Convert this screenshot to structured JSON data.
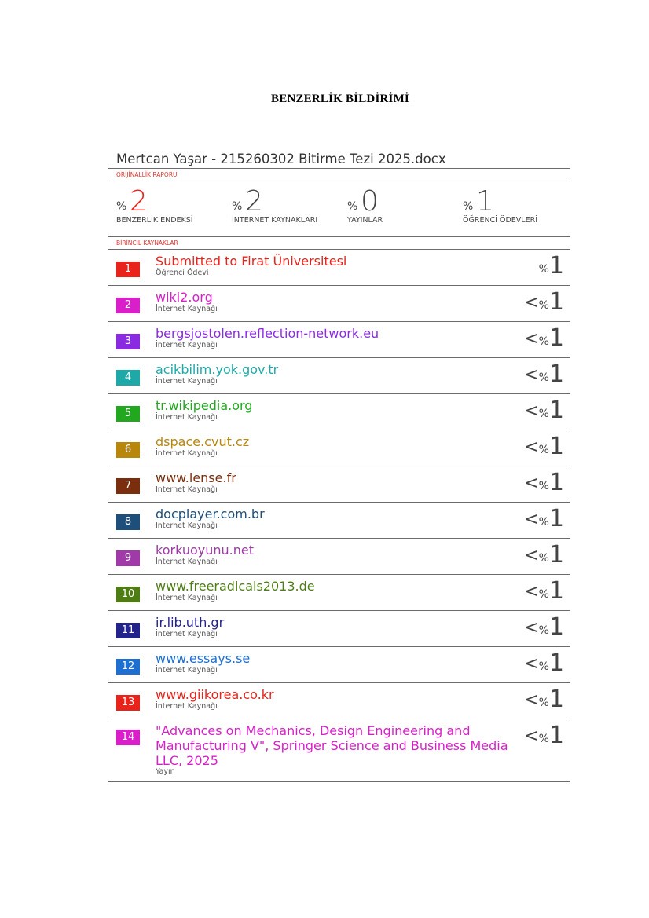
{
  "heading": "BENZERLİK BİLDİRİMİ",
  "report": {
    "title": "Mertcan Yaşar - 215260302 Bitirme Tezi 2025.docx",
    "originality_label": "ORİJİNALLİK RAPORU",
    "stats": [
      {
        "symbol": "%",
        "value": "2",
        "label": "BENZERLİK ENDEKSİ",
        "color": "#e8231c"
      },
      {
        "symbol": "%",
        "value": "2",
        "label": "İNTERNET KAYNAKLARI",
        "color": "#444444"
      },
      {
        "symbol": "%",
        "value": "0",
        "label": "YAYINLAR",
        "color": "#444444"
      },
      {
        "symbol": "%",
        "value": "1",
        "label": "ÖĞRENCİ ÖDEVLERİ",
        "color": "#444444"
      }
    ],
    "sources_label": "BİRİNCİL KAYNAKLAR",
    "sources": [
      {
        "num": "1",
        "name": "Submitted to Firat Üniversitesi",
        "type": "Öğrenci Ödevi",
        "lt": "",
        "pct_symbol": "%",
        "pct": "1",
        "color": "#e8231c"
      },
      {
        "num": "2",
        "name": "wiki2.org",
        "type": "İnternet Kaynağı",
        "lt": "<",
        "pct_symbol": "%",
        "pct": "1",
        "color": "#d81fc9"
      },
      {
        "num": "3",
        "name": "bergsjostolen.reflection-network.eu",
        "type": "İnternet Kaynağı",
        "lt": "<",
        "pct_symbol": "%",
        "pct": "1",
        "color": "#8a2be2"
      },
      {
        "num": "4",
        "name": "acikbilim.yok.gov.tr",
        "type": "İnternet Kaynağı",
        "lt": "<",
        "pct_symbol": "%",
        "pct": "1",
        "color": "#1fa8a8"
      },
      {
        "num": "5",
        "name": "tr.wikipedia.org",
        "type": "İnternet Kaynağı",
        "lt": "<",
        "pct_symbol": "%",
        "pct": "1",
        "color": "#21a81f"
      },
      {
        "num": "6",
        "name": "dspace.cvut.cz",
        "type": "İnternet Kaynağı",
        "lt": "<",
        "pct_symbol": "%",
        "pct": "1",
        "color": "#b8860b"
      },
      {
        "num": "7",
        "name": "www.lense.fr",
        "type": "İnternet Kaynağı",
        "lt": "<",
        "pct_symbol": "%",
        "pct": "1",
        "color": "#7a2e0e"
      },
      {
        "num": "8",
        "name": "docplayer.com.br",
        "type": "İnternet Kaynağı",
        "lt": "<",
        "pct_symbol": "%",
        "pct": "1",
        "color": "#1e4f7a"
      },
      {
        "num": "9",
        "name": "korkuoyunu.net",
        "type": "İnternet Kaynağı",
        "lt": "<",
        "pct_symbol": "%",
        "pct": "1",
        "color": "#a03aa8"
      },
      {
        "num": "10",
        "name": "www.freeradicals2013.de",
        "type": "İnternet Kaynağı",
        "lt": "<",
        "pct_symbol": "%",
        "pct": "1",
        "color": "#4e7d14"
      },
      {
        "num": "11",
        "name": "ir.lib.uth.gr",
        "type": "İnternet Kaynağı",
        "lt": "<",
        "pct_symbol": "%",
        "pct": "1",
        "color": "#23238c"
      },
      {
        "num": "12",
        "name": "www.essays.se",
        "type": "İnternet Kaynağı",
        "lt": "<",
        "pct_symbol": "%",
        "pct": "1",
        "color": "#1e6fd0"
      },
      {
        "num": "13",
        "name": "www.giikorea.co.kr",
        "type": "İnternet Kaynağı",
        "lt": "<",
        "pct_symbol": "%",
        "pct": "1",
        "color": "#e8231c"
      },
      {
        "num": "14",
        "name": "\"Advances on Mechanics, Design Engineering and Manufacturing V\", Springer Science and Business Media LLC, 2025",
        "type": "Yayın",
        "lt": "<",
        "pct_symbol": "%",
        "pct": "1",
        "color": "#d81fc9"
      }
    ]
  }
}
